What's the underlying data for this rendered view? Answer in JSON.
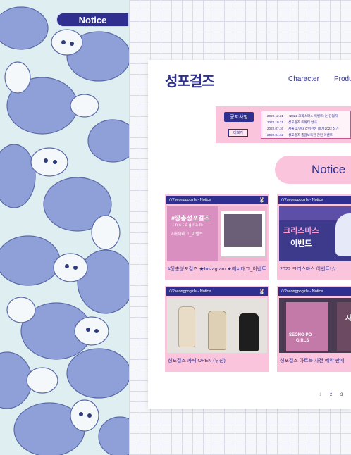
{
  "side_tab": {
    "label": "Notice"
  },
  "site": {
    "logo": "성포걸즈",
    "nav": [
      "Character",
      "Produ"
    ]
  },
  "notice_board": {
    "title": "공지사항",
    "more": "더보기",
    "rows": [
      {
        "date": "2022.12.31",
        "text": "<2022 크리스마스 이벤트>는 당첨자"
      },
      {
        "date": "2022.10.21",
        "text": "성포걸즈 트위터 안내"
      },
      {
        "date": "2022.07.16",
        "text": "서울 휴먼타 라이선싱 페어 2022 참가"
      },
      {
        "date": "2022.04.12",
        "text": "성포걸즈 총괄보육원 관련 이벤트"
      }
    ]
  },
  "section_heading": "Notice",
  "cards": [
    {
      "handle": "/I/?seongpogirls - Notice",
      "caption": "#깡총성포걸즈 ★Instagram ★해시태그_이벤트",
      "img_title": "#깡총성포걸즈",
      "img_sub": "Instagram",
      "img_sub2": "#해시태그_이벤트"
    },
    {
      "handle": "/I/?seongpogirls - Notice",
      "caption": "2022 크리스마스 이벤트!☆",
      "img_title": "크리스마스",
      "img_sub": "이벤트"
    },
    {
      "handle": "/I/?seongpogirls - Notice",
      "caption": "성포걸즈 카페 OPEN (부산)"
    },
    {
      "handle": "/I/?seongpogirls - Notice",
      "caption": "성포걸즈 아트북 사전 예약 판매",
      "img_title": "SEONG-PO",
      "img_sub": "GIRLS",
      "img_side": "사전"
    }
  ],
  "pagination": [
    "1",
    "2",
    "3"
  ],
  "colors": {
    "navy": "#2e2f8f",
    "pink": "#f9c4dc",
    "pattern_blue": "#8fa0d8",
    "pattern_bg": "#dfeef1"
  }
}
